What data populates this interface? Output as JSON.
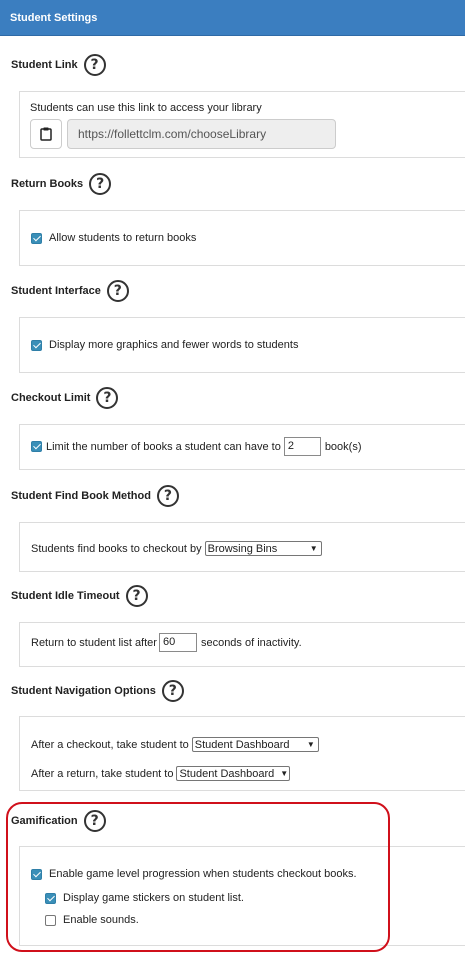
{
  "header": {
    "title": "Student Settings"
  },
  "student_link": {
    "title": "Student Link",
    "description": "Students can use this link to access your library",
    "url": "https://follettclm.com/chooseLibrary"
  },
  "return_books": {
    "title": "Return Books",
    "allow_label": "Allow students to return books",
    "allow_checked": true
  },
  "student_interface": {
    "title": "Student Interface",
    "graphics_label": "Display more graphics and fewer words to students",
    "graphics_checked": true
  },
  "checkout_limit": {
    "title": "Checkout Limit",
    "limit_label": "Limit the number of books a student can have to",
    "limit_value": "2",
    "limit_suffix": "book(s)",
    "limit_checked": true
  },
  "find_book": {
    "title": "Student Find Book Method",
    "label": "Students find books to checkout by",
    "selected": "Browsing Bins"
  },
  "idle_timeout": {
    "title": "Student Idle Timeout",
    "prefix": "Return to student list after",
    "value": "60",
    "suffix": "seconds of inactivity."
  },
  "navigation": {
    "title": "Student Navigation Options",
    "after_checkout_label": "After a checkout, take student to",
    "after_checkout_selected": "Student Dashboard",
    "after_return_label": "After a return, take student to",
    "after_return_selected": "Student Dashboard"
  },
  "gamification": {
    "title": "Gamification",
    "level_label": "Enable game level progression when students checkout books.",
    "level_checked": true,
    "stickers_label": "Display game stickers on student list.",
    "stickers_checked": true,
    "sounds_label": "Enable sounds.",
    "sounds_checked": false,
    "highlight_color": "#d0101b"
  },
  "help_glyph": "?",
  "colors": {
    "header": "#3b7ec0",
    "checkbox": "#3a8fb8"
  }
}
